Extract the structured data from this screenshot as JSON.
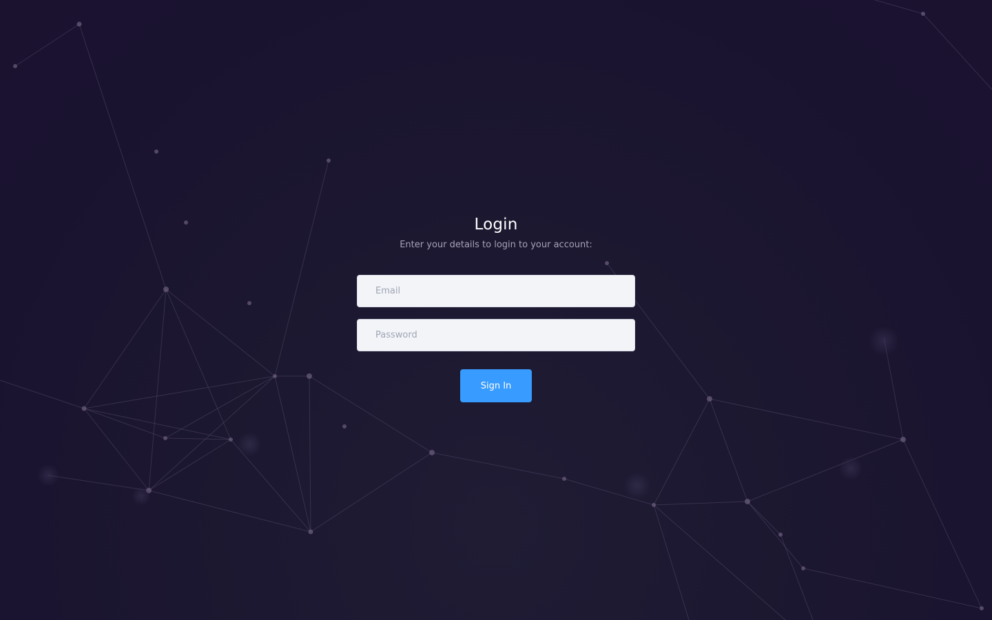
{
  "login": {
    "title": "Login",
    "subtitle": "Enter your details to login to your account:",
    "email": {
      "placeholder": "Email",
      "value": ""
    },
    "password": {
      "placeholder": "Password",
      "value": ""
    },
    "submit_label": "Sign In"
  },
  "colors": {
    "background": "#1c1730",
    "accent": "#379bff",
    "input_bg": "#f2f4f8"
  }
}
